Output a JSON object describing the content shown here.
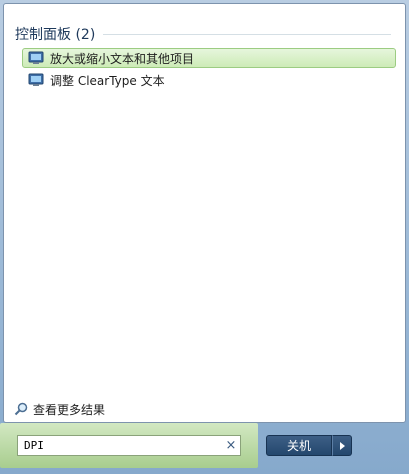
{
  "results": {
    "group_title": "控制面板 (2)",
    "items": [
      {
        "label": "放大或缩小文本和其他项目",
        "icon": "control-panel-icon",
        "selected": true
      },
      {
        "label": "调整 ClearType 文本",
        "icon": "control-panel-icon",
        "selected": false
      }
    ],
    "see_more": "查看更多结果"
  },
  "search": {
    "value": "DPI",
    "clear_icon": "×"
  },
  "shutdown": {
    "label": "关机",
    "arrow_icon": "triangle-right-icon"
  },
  "colors": {
    "selection": "#cdebb7",
    "header_text": "#1e395b",
    "shutdown_button": "#2d5078"
  }
}
